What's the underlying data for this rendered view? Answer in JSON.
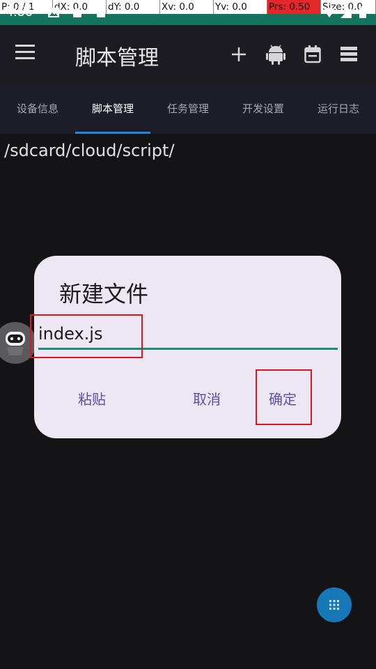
{
  "status_bar": {
    "time": "4:56",
    "debug": [
      "P: 0 / 1",
      "dX: 0.0",
      "dY: 0.0",
      "Xv: 0.0",
      "Yv: 0.0",
      "Prs: 0.50",
      "Size: 0.0"
    ]
  },
  "appbar": {
    "title": "脚本管理",
    "icons": [
      "menu-icon",
      "add-icon",
      "android-icon",
      "calendar-icon",
      "list-icon"
    ]
  },
  "tabs": [
    "设备信息",
    "脚本管理",
    "任务管理",
    "开发设置",
    "运行日志"
  ],
  "active_tab": 1,
  "path": "/sdcard/cloud/script/",
  "dialog": {
    "title": "新建文件",
    "input_value": "index.js",
    "buttons": {
      "paste": "粘贴",
      "cancel": "取消",
      "confirm": "确定"
    }
  },
  "colors": {
    "accent": "#1e88e5",
    "dialog_bg": "#ede7f4",
    "button_text": "#5d4ea8",
    "input_underline": "#1f8a73",
    "status_bar": "#16745e"
  }
}
